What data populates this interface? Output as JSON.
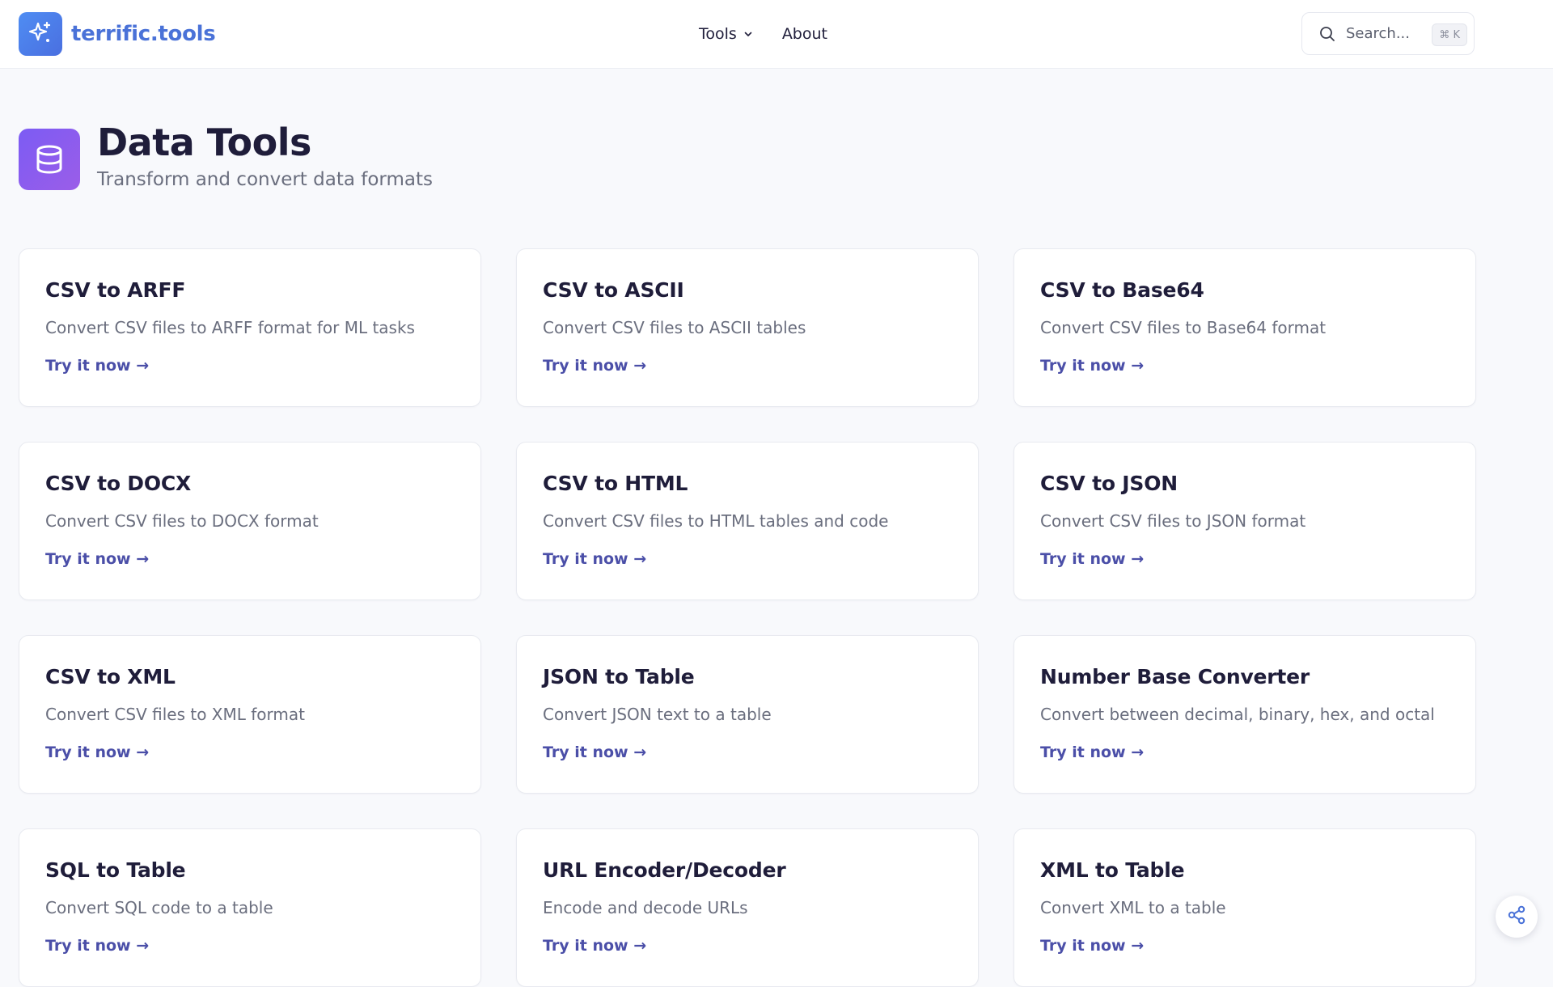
{
  "header": {
    "logo_text": "terrific.tools",
    "nav": [
      {
        "label": "Tools",
        "has_dropdown": true
      },
      {
        "label": "About",
        "has_dropdown": false
      }
    ],
    "search": {
      "placeholder": "Search...",
      "shortcut": "⌘ K"
    }
  },
  "page": {
    "title": "Data Tools",
    "subtitle": "Transform and convert data formats",
    "icon": "database-icon"
  },
  "cards": [
    {
      "title": "CSV to ARFF",
      "description": "Convert CSV files to ARFF format for ML tasks",
      "link": "Try it now →"
    },
    {
      "title": "CSV to ASCII",
      "description": "Convert CSV files to ASCII tables",
      "link": "Try it now →"
    },
    {
      "title": "CSV to Base64",
      "description": "Convert CSV files to Base64 format",
      "link": "Try it now →"
    },
    {
      "title": "CSV to DOCX",
      "description": "Convert CSV files to DOCX format",
      "link": "Try it now →"
    },
    {
      "title": "CSV to HTML",
      "description": "Convert CSV files to HTML tables and code",
      "link": "Try it now →"
    },
    {
      "title": "CSV to JSON",
      "description": "Convert CSV files to JSON format",
      "link": "Try it now →"
    },
    {
      "title": "CSV to XML",
      "description": "Convert CSV files to XML format",
      "link": "Try it now →"
    },
    {
      "title": "JSON to Table",
      "description": "Convert JSON text to a table",
      "link": "Try it now →"
    },
    {
      "title": "Number Base Converter",
      "description": "Convert between decimal, binary, hex, and octal",
      "link": "Try it now →"
    },
    {
      "title": "SQL to Table",
      "description": "Convert SQL code to a table",
      "link": "Try it now →"
    },
    {
      "title": "URL Encoder/Decoder",
      "description": "Encode and decode URLs",
      "link": "Try it now →"
    },
    {
      "title": "XML to Table",
      "description": "Convert XML to a table",
      "link": "Try it now →"
    }
  ],
  "colors": {
    "brand": "#4a72d8",
    "category_accent": "#8b5cf6",
    "link": "#4b4fa8"
  }
}
